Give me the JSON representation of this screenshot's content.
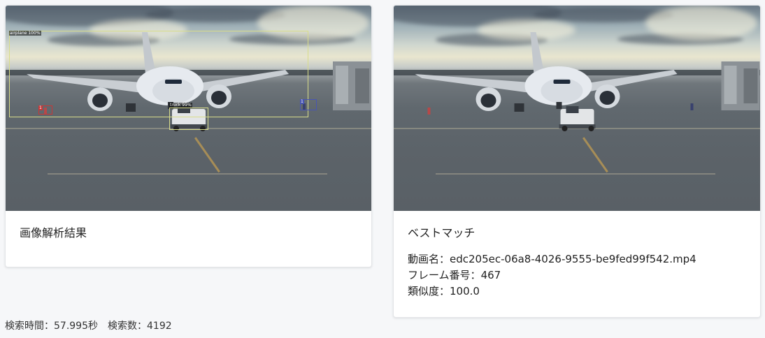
{
  "left_card": {
    "title": "画像解析結果",
    "detections": {
      "airplane_label": "airplane 100%",
      "truck_label": "truck 99%",
      "person_label": "1",
      "person2_label": "1"
    },
    "box_color": "#d9dd8a"
  },
  "right_card": {
    "title": "ベストマッチ",
    "video_name_label": "動画名：",
    "video_name_value": "edc205ec-06a8-4026-9555-be9fed99f542.mp4",
    "frame_label": "フレーム番号：",
    "frame_value": "467",
    "similarity_label": "類似度：",
    "similarity_value": "100.0"
  },
  "search_info": {
    "time_label": "検索時間：",
    "time_value": "57.995秒",
    "count_label": "検索数：",
    "count_value": "4192"
  }
}
